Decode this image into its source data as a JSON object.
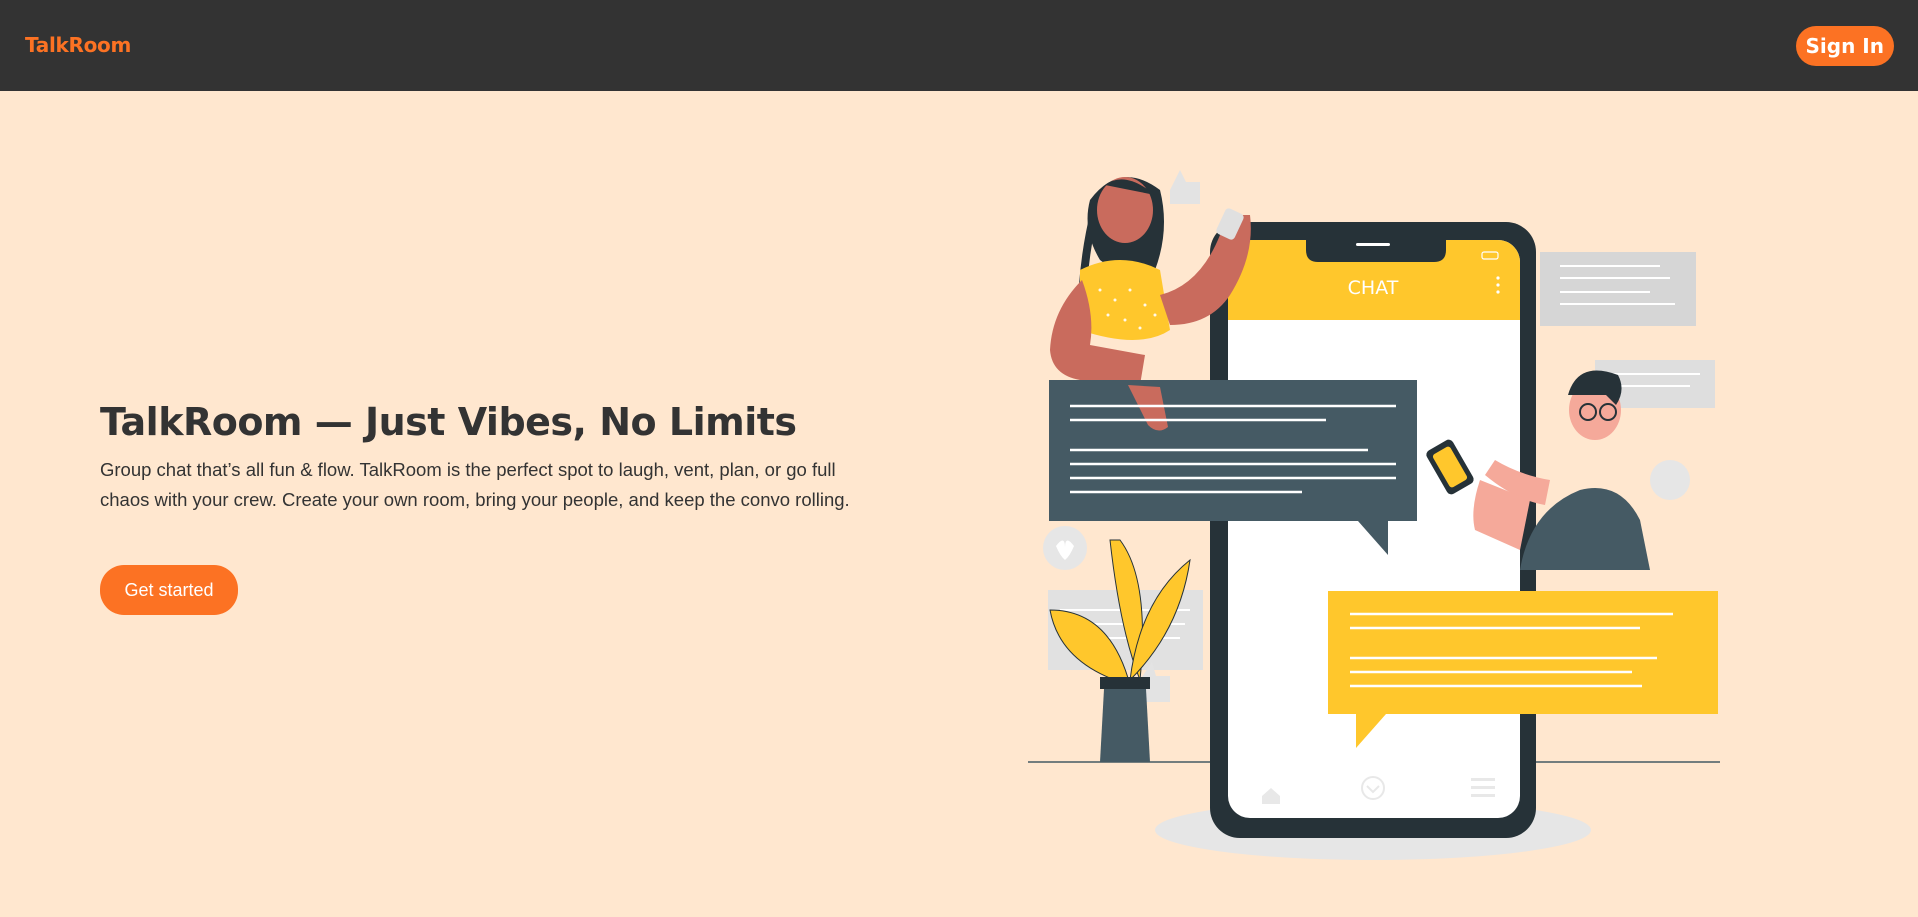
{
  "navbar": {
    "brand": "TalkRoom",
    "signin_label": "Sign In"
  },
  "hero": {
    "title": "TalkRoom — Just Vibes, No Limits",
    "description": "Group chat that’s all fun & flow. TalkRoom is the perfect spot to laugh, vent, plan, or go full chaos with your crew. Create your own room, bring your people, and keep the convo rolling.",
    "cta_label": "Get started"
  },
  "illustration": {
    "phone_header": "CHAT"
  },
  "colors": {
    "navbar_bg": "#333333",
    "page_bg": "#ffe7cf",
    "accent": "#fc7223",
    "illustration_yellow": "#ffc72c",
    "illustration_slate": "#455a64"
  }
}
